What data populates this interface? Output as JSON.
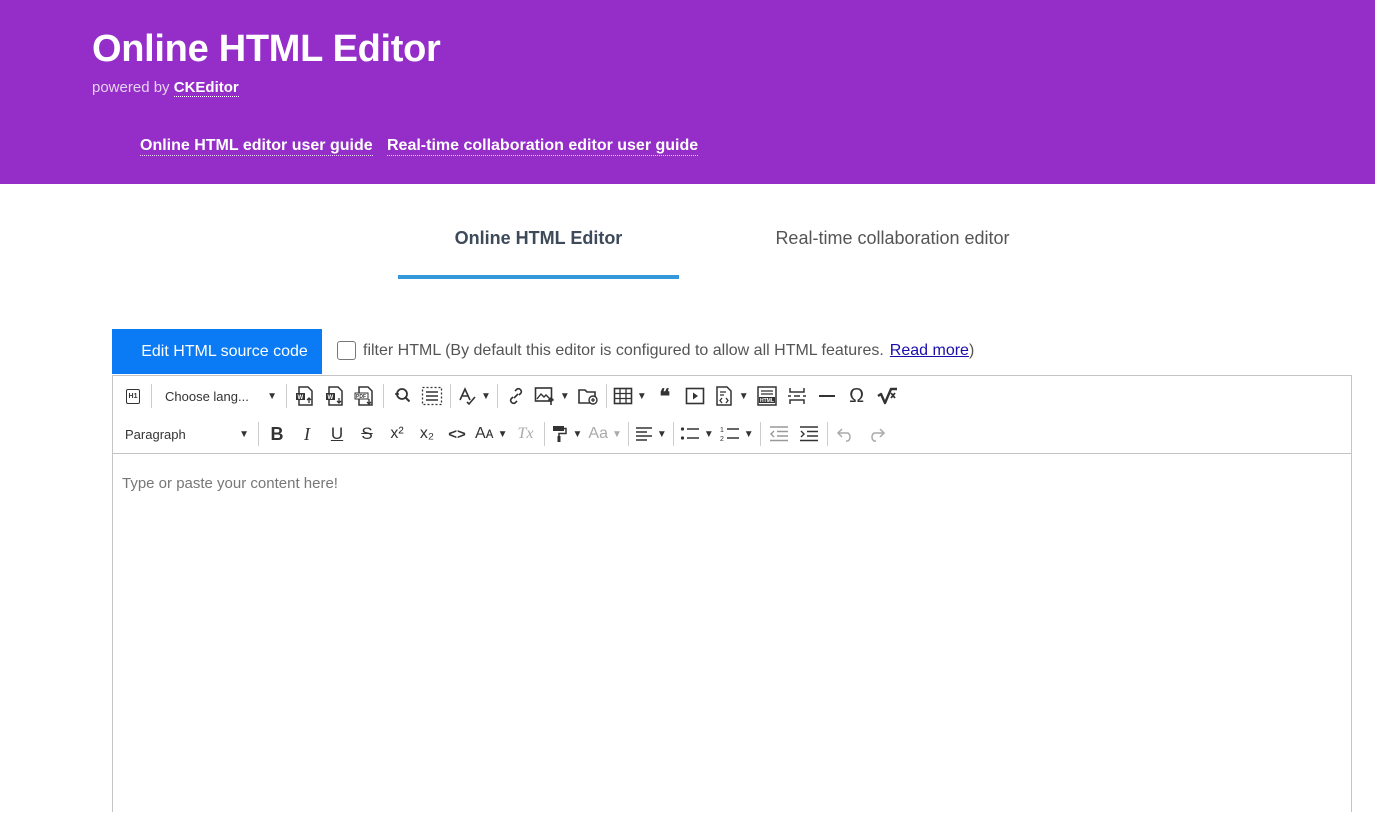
{
  "header": {
    "title": "Online HTML Editor",
    "powered_prefix": "powered by",
    "powered_brand": "CKEditor",
    "links": [
      "Online HTML editor user guide",
      "Real-time collaboration editor user guide"
    ]
  },
  "tabs": [
    {
      "label": "Online HTML Editor",
      "active": true
    },
    {
      "label": "Real-time collaboration editor",
      "active": false
    }
  ],
  "source_button": {
    "label": "Edit HTML source code"
  },
  "filter": {
    "checked": false,
    "label": "filter HTML (By default this editor is configured to allow all HTML features.",
    "link": "Read more",
    "suffix": ")"
  },
  "toolbar": {
    "language_dropdown": "Choose lang...",
    "heading_dropdown": "Paragraph",
    "heading_badge": "H1",
    "pdf_badge": "PDF",
    "html_badge": "HTML",
    "bold": "B",
    "italic": "I",
    "underline": "U",
    "strikethrough": "S",
    "superscript": "x²",
    "subscript": "x₂",
    "code": "<>",
    "font_size": "Aᴀ",
    "remove_format": "Tx",
    "font_case": "Aa",
    "omega": "Ω",
    "quote": "❝"
  },
  "editor": {
    "placeholder": "Type or paste your content here!"
  },
  "colors": {
    "header_bg": "#952dc8",
    "accent_blue": "#0a7bf4",
    "tab_underline": "#3498db"
  }
}
